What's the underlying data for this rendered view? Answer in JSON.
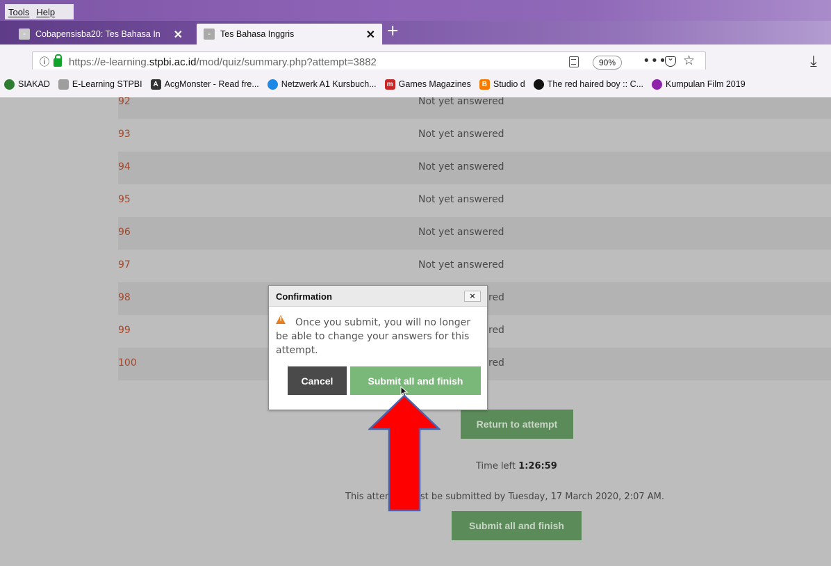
{
  "menubar": {
    "items": [
      "Tools",
      "Help"
    ]
  },
  "tabs": [
    {
      "label": "Cobapensisba20: Tes Bahasa In",
      "close": "✕"
    },
    {
      "label": "Tes Bahasa Inggris",
      "close": "✕"
    }
  ],
  "newtab": "+",
  "navbar": {
    "url_prefix": "https://e-learning.",
    "url_domain": "stpbi.ac.id",
    "url_path": "/mod/quiz/summary.php?attempt=3882",
    "zoom": "90%",
    "more": "•••"
  },
  "bookmarks": [
    {
      "label": "SIAKAD",
      "icon": "globe-icon",
      "color": "#2e7d32"
    },
    {
      "label": "E-Learning STPBI",
      "icon": "page-icon",
      "color": "#9e9e9e"
    },
    {
      "label": "AcgMonster - Read fre...",
      "icon": "acg-icon",
      "color": "#333333"
    },
    {
      "label": "Netzwerk A1 Kursbuch...",
      "icon": "netzwerk-icon",
      "color": "#1e88e5"
    },
    {
      "label": "Games Magazines",
      "icon": "magazine-icon",
      "color": "#c62828"
    },
    {
      "label": "Studio d",
      "icon": "blogger-icon",
      "color": "#f57c00"
    },
    {
      "label": "The red haired boy :: C...",
      "icon": "face-icon",
      "color": "#111111"
    },
    {
      "label": "Kumpulan Film 2019",
      "icon": "film-icon",
      "color": "#8e24aa"
    }
  ],
  "questions": [
    {
      "num": "92",
      "status": "Not yet answered"
    },
    {
      "num": "93",
      "status": "Not yet answered"
    },
    {
      "num": "94",
      "status": "Not yet answered"
    },
    {
      "num": "95",
      "status": "Not yet answered"
    },
    {
      "num": "96",
      "status": "Not yet answered"
    },
    {
      "num": "97",
      "status": "Not yet answered"
    },
    {
      "num": "98",
      "status": "red"
    },
    {
      "num": "99",
      "status": "red"
    },
    {
      "num": "100",
      "status": "red"
    }
  ],
  "return_button": "Return to attempt",
  "time_left_label": "Time left",
  "time_left_value": "1:26:59",
  "deadline_text": "This attempt must be submitted by Tuesday, 17 March 2020, 2:07 AM.",
  "submit_page_button": "Submit all and finish",
  "modal": {
    "title": "Confirmation",
    "close": "×",
    "message": "Once you submit, you will no longer be able to change your answers for this attempt.",
    "cancel": "Cancel",
    "submit": "Submit all and finish"
  },
  "colors": {
    "arrow": "#ff0000",
    "arrow_outline": "#4a63b0",
    "submit_green": "#7ab87a",
    "link_orange": "#a2482c"
  }
}
